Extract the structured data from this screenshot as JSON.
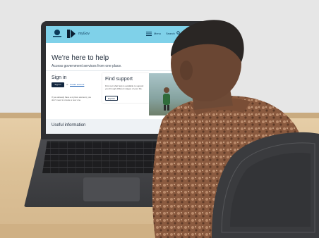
{
  "website": {
    "header": {
      "brand": "myGov",
      "menu_label": "Menu",
      "search_label": "Search"
    },
    "hero": {
      "title": "We're here to help",
      "subtitle": "Access government services from one place."
    },
    "sign_in": {
      "title": "Sign in",
      "button_label": "Sign in",
      "or_text": "or",
      "create_link": "Create account",
      "note": "If you already have a myGov account, you don't need to create a new one."
    },
    "find_support": {
      "title": "Find support",
      "text": "Find out what help is available to support you through different stages of your life.",
      "button_label": "Explore"
    },
    "useful_info": {
      "title": "Useful information"
    }
  },
  "colors": {
    "header_bg": "#7fd1e9",
    "navy": "#12263f",
    "wall": "#e6e6e6",
    "desk": "#dcc197",
    "shirt": "#8a5a3f",
    "chair": "#3a3b3e"
  }
}
